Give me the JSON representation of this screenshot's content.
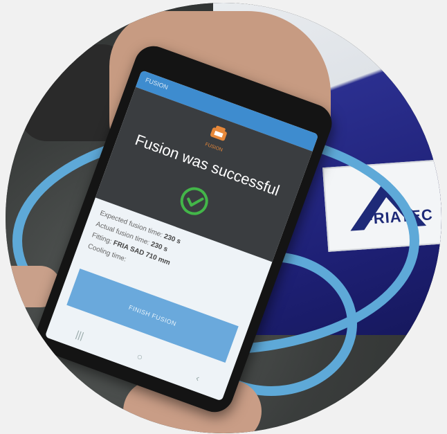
{
  "photo": {
    "brand_logo_text": "FRIATEC"
  },
  "app": {
    "topbar_label": "FUSION",
    "icon_label": "FUSION",
    "title": "Fusion was successful",
    "info": {
      "expected_label": "Expected fusion time:",
      "expected_value": "230 s",
      "actual_label": "Actual fusion time:",
      "actual_value": "230 s",
      "fitting_label": "Fitting:",
      "fitting_value": "FRIA SAD 710 mm",
      "cooling_label": "Cooling time:"
    },
    "finish_button": "FINISH FUSION",
    "nav": {
      "recent": "|||",
      "home": "○",
      "back": "‹"
    }
  },
  "colors": {
    "accent": "#3e8ccf",
    "success": "#43b649",
    "machine_icon": "#e6883a",
    "hose": "#5ea9d8",
    "machine_body": "#1e2075"
  }
}
